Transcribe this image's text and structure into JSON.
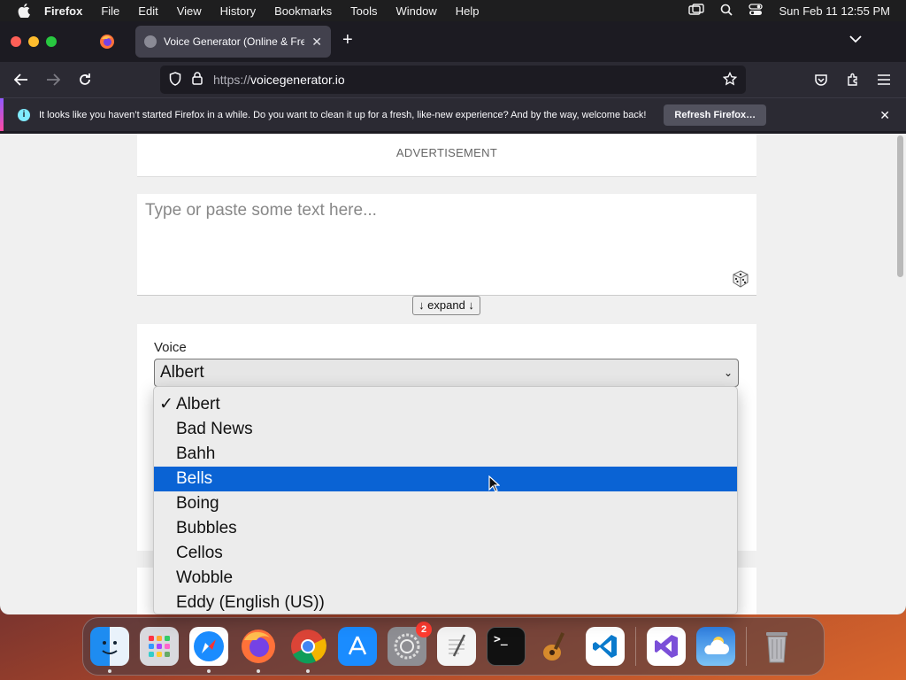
{
  "menubar": {
    "items": [
      "Firefox",
      "File",
      "Edit",
      "View",
      "History",
      "Bookmarks",
      "Tools",
      "Window",
      "Help"
    ],
    "clock": "Sun Feb 11  12:55 PM"
  },
  "browser": {
    "tab_title": "Voice Generator (Online & Free)",
    "url_scheme": "https://",
    "url_host": "voicegenerator.io",
    "notification": "It looks like you haven’t started Firefox in a while. Do you want to clean it up for a fresh, like-new experience? And by the way, welcome back!",
    "refresh_label": "Refresh Firefox…"
  },
  "page": {
    "ad_label": "ADVERTISEMENT",
    "textarea_placeholder": "Type or paste some text here...",
    "expand_label": "↓ expand ↓",
    "voice_label": "Voice",
    "voice_selected": "Albert"
  },
  "dropdown": {
    "check_glyph": "✓",
    "options": [
      "Albert",
      "Bad News",
      "Bahh",
      "Bells",
      "Boing",
      "Bubbles",
      "Cellos",
      "Wobble",
      "Eddy (English (US))"
    ],
    "selected_index": 0,
    "highlighted_index": 3
  },
  "dock": {
    "settings_badge": "2",
    "apps": [
      "finder-icon",
      "launchpad-icon",
      "safari-icon",
      "firefox-icon",
      "chrome-icon",
      "app-store-icon",
      "system-settings-icon",
      "textedit-icon",
      "terminal-icon",
      "garageband-icon",
      "vscode-icon",
      "visual-studio-icon",
      "weather-icon",
      "trash-icon"
    ]
  },
  "colors": {
    "highlight": "#0a63d4",
    "notification_stripe": "#9059ff"
  }
}
